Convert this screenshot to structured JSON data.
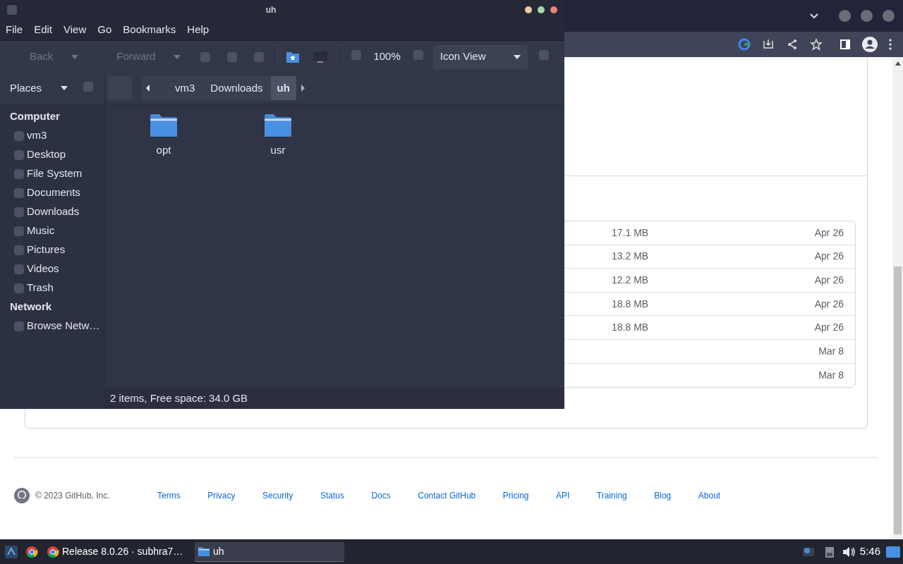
{
  "browser": {
    "assets": [
      {
        "size": "17.1 MB",
        "date": "Apr 26"
      },
      {
        "size": "13.2 MB",
        "date": "Apr 26"
      },
      {
        "size": "12.2 MB",
        "date": "Apr 26"
      },
      {
        "size": "18.8 MB",
        "date": "Apr 26"
      },
      {
        "size": "18.8 MB",
        "date": "Apr 26"
      },
      {
        "date": "Mar 8"
      },
      {
        "date": "Mar 8"
      }
    ],
    "footer": {
      "copyright": "© 2023 GitHub, Inc.",
      "links": [
        "Terms",
        "Privacy",
        "Security",
        "Status",
        "Docs",
        "Contact GitHub",
        "Pricing",
        "API",
        "Training",
        "Blog",
        "About"
      ]
    }
  },
  "file_manager": {
    "title": "uh",
    "menu": [
      "File",
      "Edit",
      "View",
      "Go",
      "Bookmarks",
      "Help"
    ],
    "toolbar": {
      "back": "Back",
      "forward": "Forward",
      "zoom": "100%",
      "view_mode": "Icon View"
    },
    "places_label": "Places",
    "breadcrumb": [
      {
        "label": "vm3",
        "selected": false
      },
      {
        "label": "Downloads",
        "selected": false
      },
      {
        "label": "uh",
        "selected": true
      }
    ],
    "sidebar": [
      {
        "heading": "Computer",
        "items": [
          "vm3",
          "Desktop",
          "File System",
          "Documents",
          "Downloads",
          "Music",
          "Pictures",
          "Videos",
          "Trash"
        ]
      },
      {
        "heading": "Network",
        "items": [
          "Browse Netw…"
        ]
      }
    ],
    "files": [
      "opt",
      "usr"
    ],
    "status": "2 items, Free space: 34.0 GB"
  },
  "taskbar": {
    "tasks": [
      {
        "label": "Release 8.0.26 · subhra7…",
        "kind": "browser",
        "selected": false
      },
      {
        "label": "uh",
        "kind": "folder",
        "selected": true
      }
    ],
    "clock": "5:46"
  }
}
